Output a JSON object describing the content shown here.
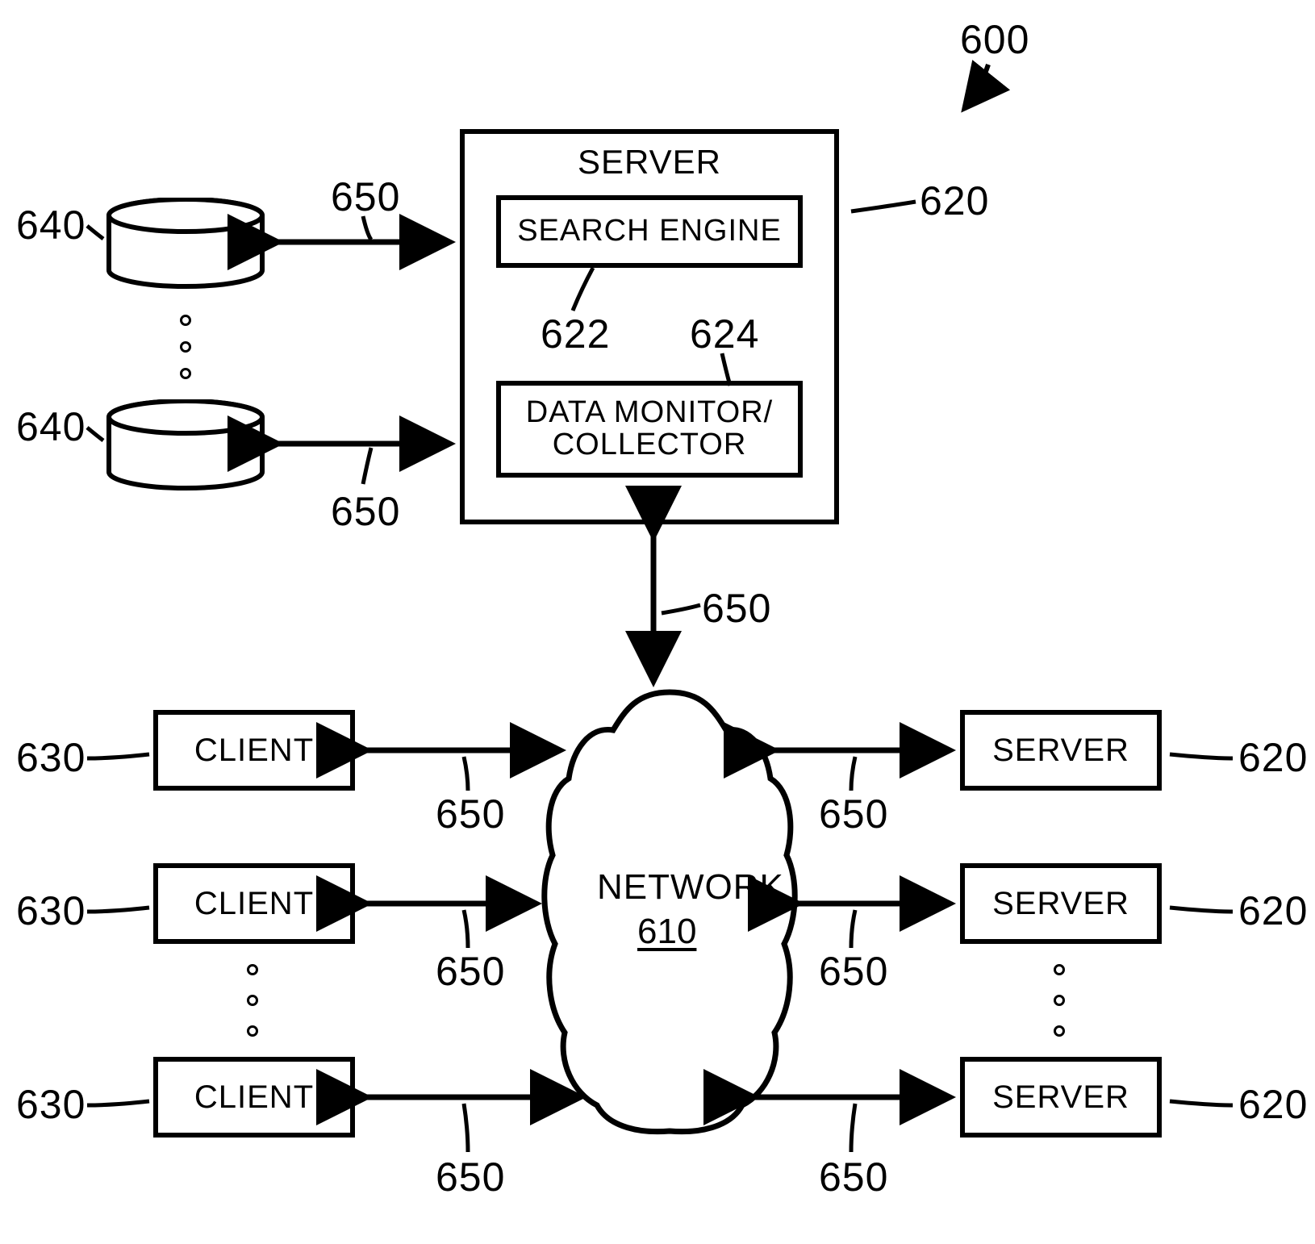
{
  "figure_ref": "600",
  "server_box": {
    "title": "SERVER",
    "search_engine": "SEARCH ENGINE",
    "search_engine_ref": "622",
    "data_monitor": "DATA MONITOR/\nCOLLECTOR",
    "data_monitor_ref": "624",
    "ref": "620"
  },
  "databases": {
    "ref": "640"
  },
  "links": {
    "ref": "650"
  },
  "network": {
    "label": "NETWORK",
    "ref": "610"
  },
  "clients": {
    "label": "CLIENT",
    "ref": "630"
  },
  "servers": {
    "label": "SERVER",
    "ref": "620"
  }
}
